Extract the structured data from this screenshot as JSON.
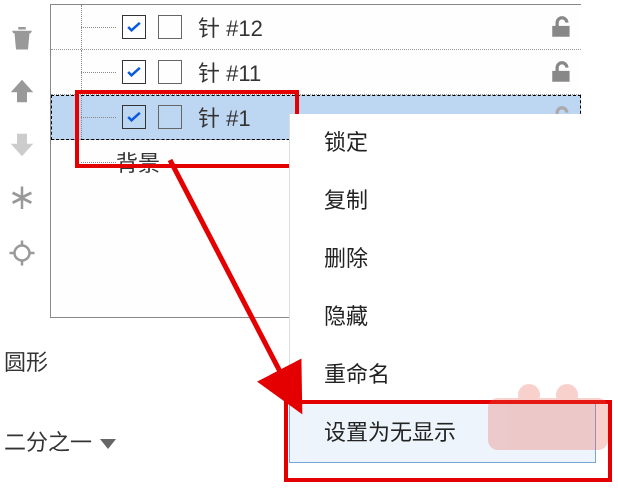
{
  "toolbar_icons": [
    "trash-icon",
    "arrow-up-icon",
    "arrow-down-icon",
    "asterisk-icon",
    "crosshair-icon"
  ],
  "layers": [
    {
      "checked": true,
      "box2": false,
      "label": "针 #12",
      "locked": true
    },
    {
      "checked": true,
      "box2": false,
      "label": "针 #11",
      "locked": true
    },
    {
      "checked": true,
      "box2": false,
      "label": "针 #1",
      "locked": true,
      "selected": true
    },
    {
      "checked": false,
      "box2": null,
      "label": "背景",
      "locked": false
    }
  ],
  "menu": {
    "items": [
      "锁定",
      "复制",
      "删除",
      "隐藏",
      "重命名",
      "设置为无显示"
    ],
    "selected_index": 5
  },
  "bottom": {
    "shape_label": "圆形",
    "fraction_label": "二分之一"
  }
}
